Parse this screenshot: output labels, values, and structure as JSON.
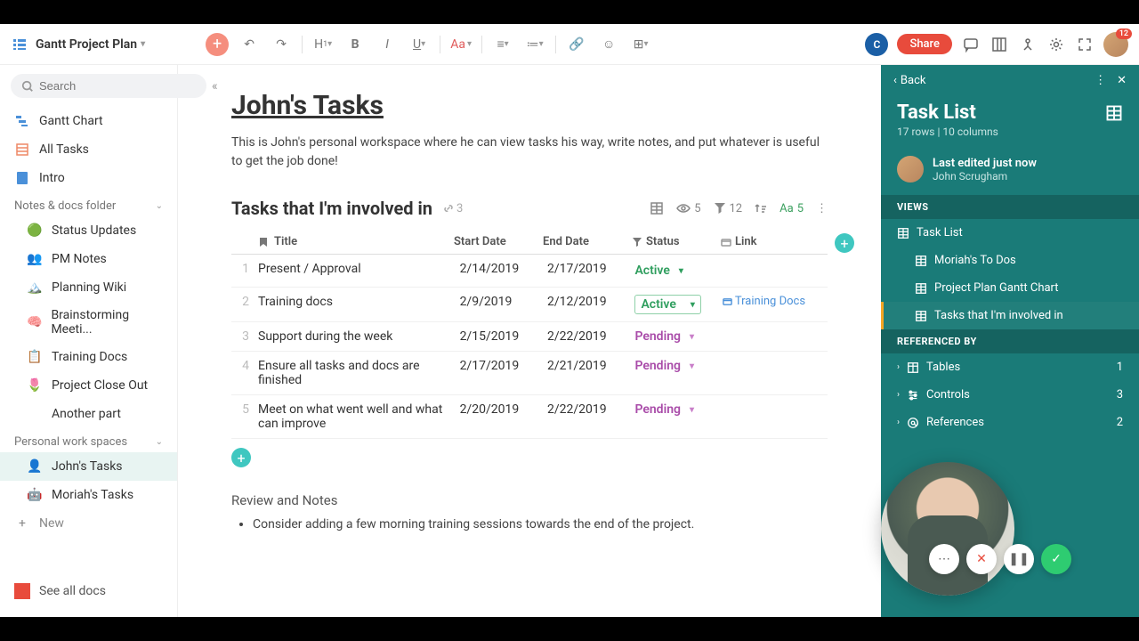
{
  "doc_title": "Gantt Project Plan",
  "search_placeholder": "Search",
  "avatar_letter": "C",
  "share_label": "Share",
  "notif_count": "12",
  "sidebar": {
    "top": [
      {
        "icon": "gantt",
        "label": "Gantt Chart"
      },
      {
        "icon": "table",
        "label": "All Tasks"
      },
      {
        "icon": "doc",
        "label": "Intro"
      }
    ],
    "section1": "Notes & docs folder",
    "notes": [
      {
        "emoji": "🟢",
        "label": "Status Updates"
      },
      {
        "emoji": "👥",
        "label": "PM Notes"
      },
      {
        "emoji": "🏔️",
        "label": "Planning Wiki"
      },
      {
        "emoji": "🧠",
        "label": "Brainstorming Meeti..."
      },
      {
        "emoji": "📋",
        "label": "Training Docs"
      },
      {
        "emoji": "🌷",
        "label": "Project Close Out"
      },
      {
        "emoji": "",
        "label": "Another part"
      }
    ],
    "section2": "Personal work spaces",
    "personal": [
      {
        "emoji": "👤",
        "label": "John's Tasks",
        "active": true
      },
      {
        "emoji": "🤖",
        "label": "Moriah's Tasks"
      }
    ],
    "new_label": "New",
    "footer": "See all docs"
  },
  "page": {
    "title": "John's Tasks",
    "desc": "This is John's personal workspace where he can view tasks his way, write notes, and put whatever is useful to get the job done!",
    "section_title": "Tasks that I'm involved in",
    "link_count": "3",
    "views_count": "5",
    "filter_count": "12",
    "format_count": "5",
    "columns": {
      "title": "Title",
      "start": "Start Date",
      "end": "End Date",
      "status": "Status",
      "link": "Link"
    },
    "rows": [
      {
        "n": "1",
        "title": "Present / Approval",
        "start": "2/14/2019",
        "end": "2/17/2019",
        "status": "Active",
        "status_type": "active",
        "link": ""
      },
      {
        "n": "2",
        "title": "Training docs",
        "start": "2/9/2019",
        "end": "2/12/2019",
        "status": "Active",
        "status_type": "active-boxed",
        "link": "Training Docs"
      },
      {
        "n": "3",
        "title": "Support during the week",
        "start": "2/15/2019",
        "end": "2/22/2019",
        "status": "Pending",
        "status_type": "pending",
        "link": ""
      },
      {
        "n": "4",
        "title": "Ensure all tasks and docs are finished",
        "start": "2/17/2019",
        "end": "2/21/2019",
        "status": "Pending",
        "status_type": "pending",
        "link": ""
      },
      {
        "n": "5",
        "title": "Meet on what went well and what can improve",
        "start": "2/20/2019",
        "end": "2/22/2019",
        "status": "Pending",
        "status_type": "pending",
        "link": ""
      }
    ],
    "notes_h": "Review and Notes",
    "notes_item": "Consider adding a few morning training sessions towards the end of the project."
  },
  "rpanel": {
    "back": "Back",
    "title": "Task List",
    "sub": "17 rows | 10 columns",
    "edited_label": "Last edited just now",
    "editor_name": "John Scrugham",
    "views_h": "VIEWS",
    "views": [
      {
        "label": "Task List",
        "sub": false
      },
      {
        "label": "Moriah's To Dos",
        "sub": true
      },
      {
        "label": "Project Plan Gantt Chart",
        "sub": true
      },
      {
        "label": "Tasks that I'm involved in",
        "sub": true,
        "active": true
      }
    ],
    "ref_h": "REFERENCED BY",
    "refs": [
      {
        "icon": "table",
        "label": "Tables",
        "count": "1"
      },
      {
        "icon": "controls",
        "label": "Controls",
        "count": "3"
      },
      {
        "icon": "at",
        "label": "References",
        "count": "2"
      }
    ]
  }
}
